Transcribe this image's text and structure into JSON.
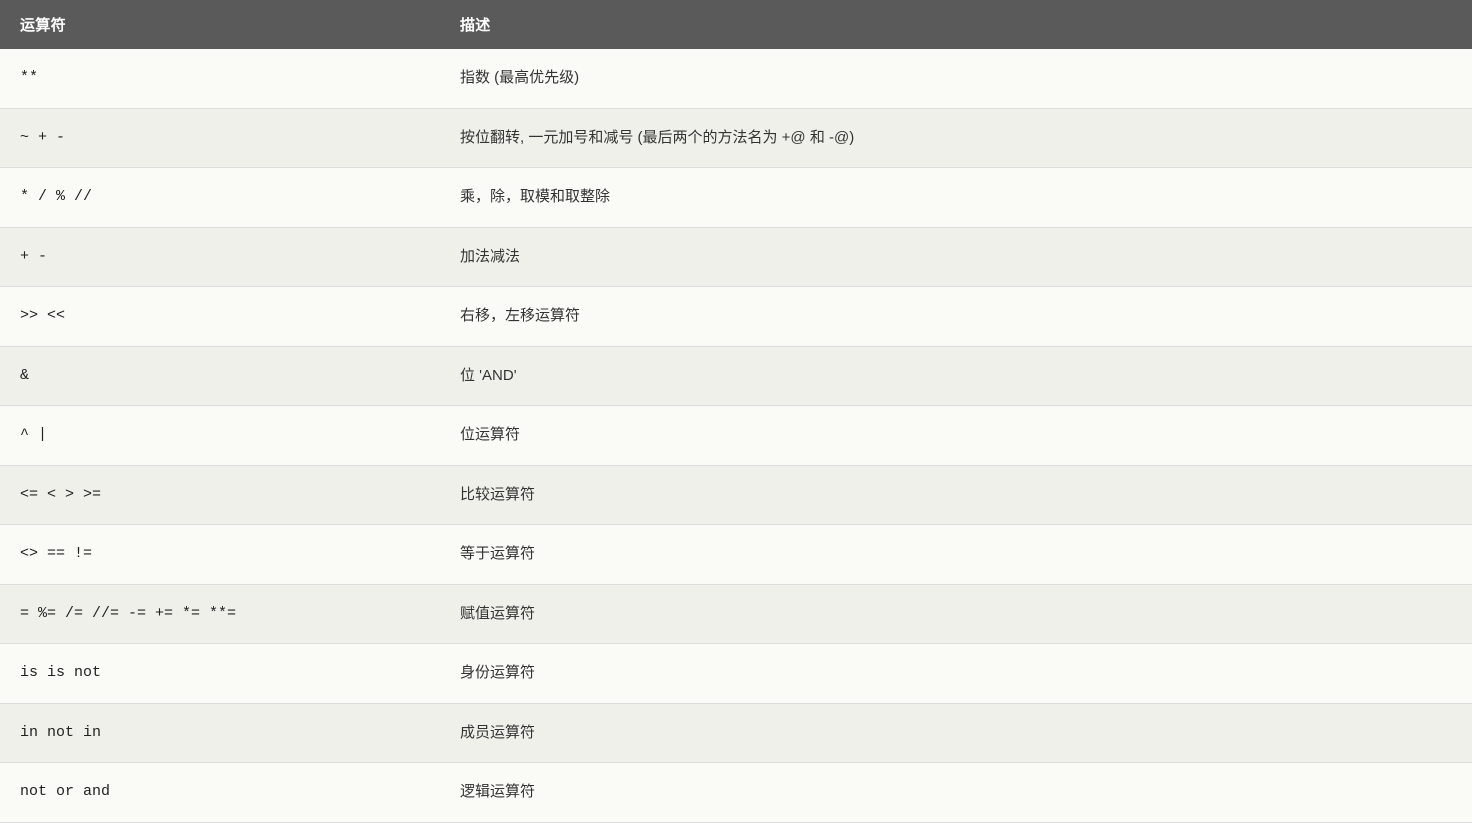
{
  "table": {
    "headers": [
      {
        "key": "operator",
        "label": "运算符"
      },
      {
        "key": "description",
        "label": "描述"
      }
    ],
    "rows": [
      {
        "operator": "**",
        "description": "指数 (最高优先级)"
      },
      {
        "operator": "~ + -",
        "description": "按位翻转, 一元加号和减号 (最后两个的方法名为 +@ 和 -@)"
      },
      {
        "operator": "* / % //",
        "description": "乘，除，取模和取整除"
      },
      {
        "operator": "+ -",
        "description": "加法减法"
      },
      {
        "operator": ">> <<",
        "description": "右移，左移运算符"
      },
      {
        "operator": "&",
        "description": "位 'AND'"
      },
      {
        "operator": "^ |",
        "description": "位运算符"
      },
      {
        "operator": "<= < > >=",
        "description": "比较运算符"
      },
      {
        "operator": "<> == !=",
        "description": "等于运算符"
      },
      {
        "operator": "= %= /= //= -= += *= **=",
        "description": "赋值运算符"
      },
      {
        "operator": "is is not",
        "description": "身份运算符"
      },
      {
        "operator": "in not in",
        "description": "成员运算符"
      },
      {
        "operator": "not or and",
        "description": "逻辑运算符"
      }
    ]
  }
}
